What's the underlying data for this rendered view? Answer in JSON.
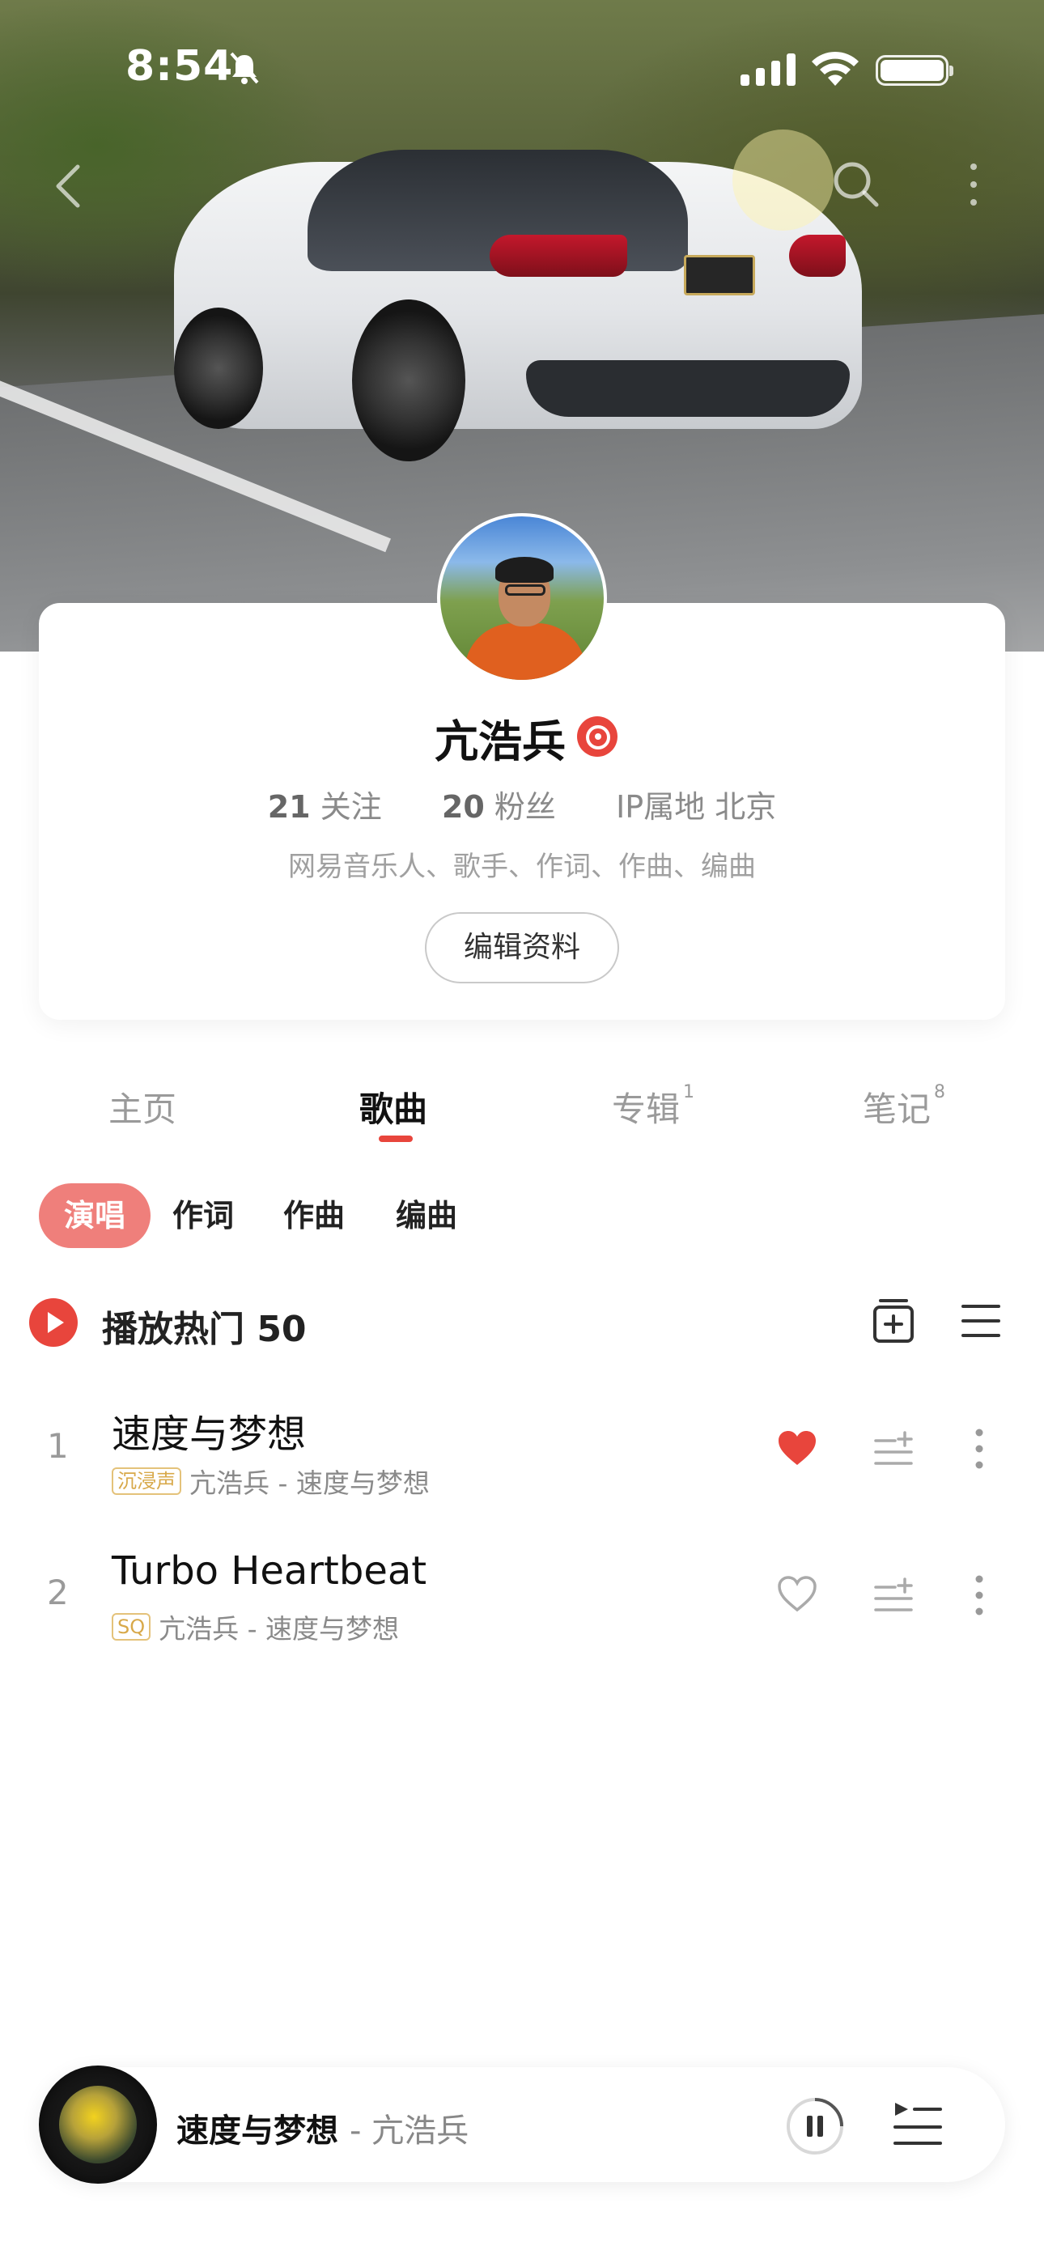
{
  "status_bar": {
    "time": "8:54"
  },
  "profile": {
    "name": "亢浩兵",
    "following_count": "21",
    "following_label": "关注",
    "followers_count": "20",
    "followers_label": "粉丝",
    "ip_location": "IP属地 北京",
    "bio": "网易音乐人、歌手、作词、作曲、编曲",
    "edit_button": "编辑资料"
  },
  "tabs": [
    {
      "label": "主页",
      "badge": ""
    },
    {
      "label": "歌曲",
      "badge": "",
      "active": true
    },
    {
      "label": "专辑",
      "badge": "1"
    },
    {
      "label": "笔记",
      "badge": "8"
    }
  ],
  "role_filters": [
    {
      "label": "演唱",
      "active": true
    },
    {
      "label": "作词"
    },
    {
      "label": "作曲"
    },
    {
      "label": "编曲"
    }
  ],
  "play_all": {
    "label": "播放热门 50"
  },
  "songs": [
    {
      "index": "1",
      "title": "速度与梦想",
      "tag": "沉浸声",
      "meta": "亢浩兵 - 速度与梦想",
      "liked": true
    },
    {
      "index": "2",
      "title": "Turbo Heartbeat",
      "tag": "SQ",
      "meta": "亢浩兵 - 速度与梦想",
      "liked": false
    }
  ],
  "mini_player": {
    "title": "速度与梦想",
    "artist": "- 亢浩兵"
  },
  "colors": {
    "accent": "#e8453c",
    "chip_active": "#ef7f7b",
    "tag_gold": "#d8a94a"
  }
}
